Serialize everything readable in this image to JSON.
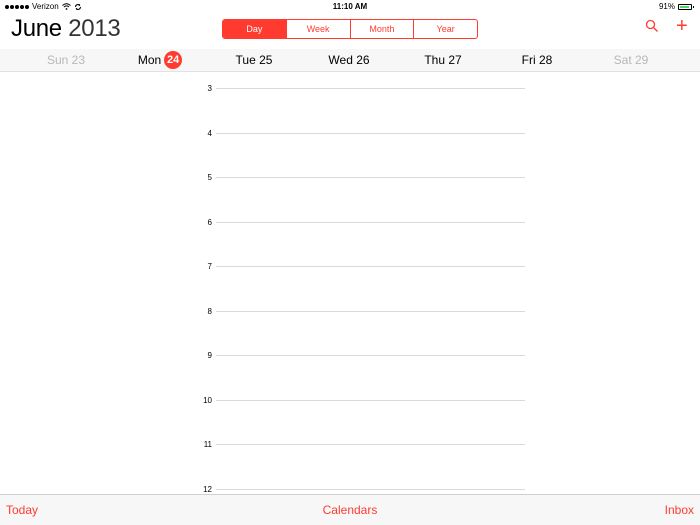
{
  "status_bar": {
    "carrier": "Verizon",
    "time": "11:10 AM",
    "battery": "91%",
    "battery_level": 0.91
  },
  "header": {
    "month": "June",
    "year": "2013",
    "view_tabs": [
      {
        "label": "Day",
        "active": true
      },
      {
        "label": "Week",
        "active": false
      },
      {
        "label": "Month",
        "active": false
      },
      {
        "label": "Year",
        "active": false
      }
    ],
    "search_icon": "search-icon",
    "add_icon": "plus-icon",
    "add_glyph": "+"
  },
  "week": [
    {
      "label": "Sun 23",
      "muted": true
    },
    {
      "label": "Mon",
      "badge": "24"
    },
    {
      "label": "Tue 25"
    },
    {
      "label": "Wed 26"
    },
    {
      "label": "Thu 27"
    },
    {
      "label": "Fri 28"
    },
    {
      "label": "Sat 29",
      "muted": true
    }
  ],
  "hours": [
    "3",
    "4",
    "5",
    "6",
    "7",
    "8",
    "9",
    "10",
    "11",
    "12"
  ],
  "toolbar": {
    "today": "Today",
    "calendars": "Calendars",
    "inbox": "Inbox"
  },
  "colors": {
    "accent": "#ff3b30",
    "battery_fill": "#4cd964"
  }
}
